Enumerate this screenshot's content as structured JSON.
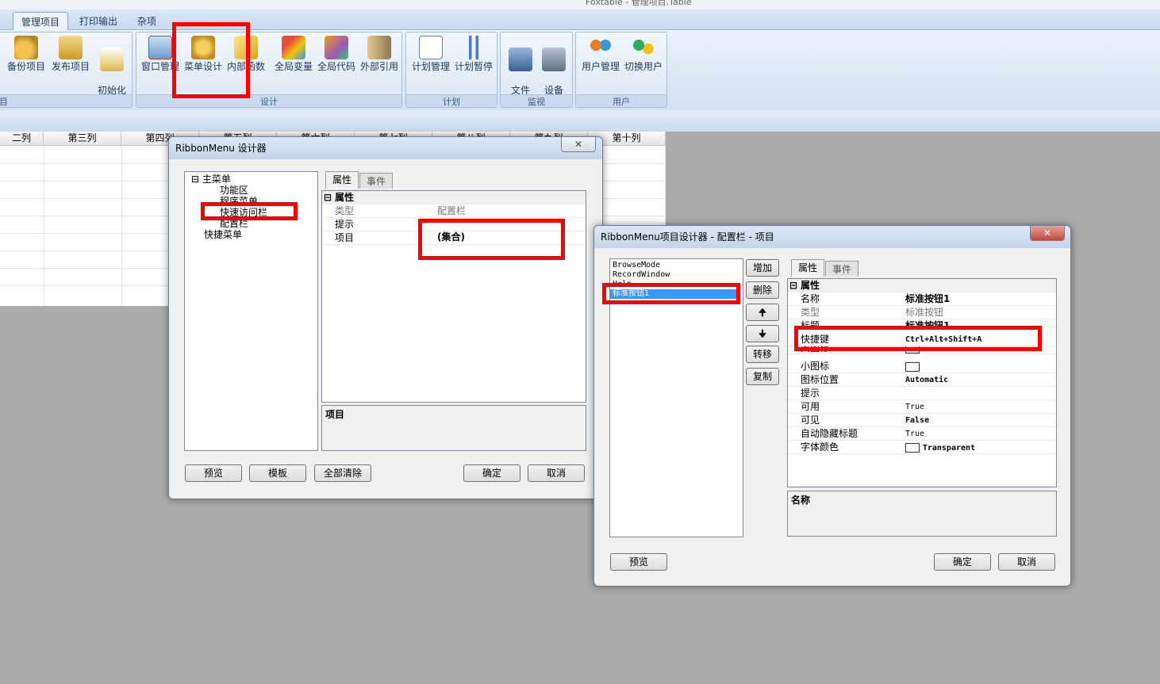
{
  "window_title": "Foxtable - 管理项目.Table",
  "tabs": [
    "管理项目",
    "打印输出",
    "杂项"
  ],
  "ribbon": {
    "groups": [
      {
        "label": "目",
        "buttons": [
          "备份项目",
          "发布项目",
          "初始化\n项目"
        ]
      },
      {
        "label": "设计",
        "buttons": [
          "窗口管理",
          "菜单设计",
          "内部函数",
          "全局变量",
          "全局代码",
          "外部引用"
        ]
      },
      {
        "label": "计划",
        "buttons": [
          "计划管理",
          "计划暂停"
        ]
      },
      {
        "label": "监视",
        "buttons": [
          "文件\n监视器",
          "设备\n监视器"
        ]
      },
      {
        "label": "用户",
        "buttons": [
          "用户管理",
          "切换用户"
        ]
      }
    ]
  },
  "grid": {
    "columns": [
      "二列",
      "第三列",
      "第四列",
      "第五列",
      "第六列",
      "第七列",
      "第八列",
      "第九列",
      "第十列"
    ]
  },
  "dialog1": {
    "title": "RibbonMenu 设计器",
    "close": "✕",
    "tree": {
      "root": "主菜单",
      "children": [
        "功能区",
        "程序菜单",
        "快速访问栏",
        "配置栏"
      ],
      "root2": "快捷菜单"
    },
    "tabs": [
      "属性",
      "事件"
    ],
    "section": "属性",
    "props": [
      {
        "k": "类型",
        "v": "配置栏"
      },
      {
        "k": "提示",
        "v": ""
      },
      {
        "k": "项目",
        "v": "(集合)"
      }
    ],
    "desc_title": "项目",
    "buttons": {
      "preview": "预览",
      "template": "模板",
      "clear": "全部清除",
      "ok": "确定",
      "cancel": "取消"
    }
  },
  "dialog2": {
    "title": "RibbonMenu项目设计器 - 配置栏 - 项目",
    "close": "✕",
    "list": [
      "BrowseMode",
      "RecordWindow",
      "Help",
      "标准按钮1"
    ],
    "side_buttons": {
      "add": "增加",
      "delete": "删除",
      "up": "🠉",
      "down": "🠋",
      "move": "转移",
      "copy": "复制"
    },
    "tabs": [
      "属性",
      "事件"
    ],
    "section": "属性",
    "props": [
      {
        "k": "名称",
        "v": "标准按钮1",
        "bold": true
      },
      {
        "k": "类型",
        "v": "标准按钮",
        "bold": false
      },
      {
        "k": "标题",
        "v": "标准按钮1",
        "bold": true
      },
      {
        "k": "快捷键",
        "v": "Ctrl+Alt+Shift+A",
        "bold": true
      },
      {
        "k": "大图标",
        "v": "",
        "bold": false
      },
      {
        "k": "小图标",
        "v": "",
        "bold": false
      },
      {
        "k": "图标位置",
        "v": "Automatic",
        "bold": true
      },
      {
        "k": "提示",
        "v": "",
        "bold": false
      },
      {
        "k": "可用",
        "v": "True",
        "bold": false
      },
      {
        "k": "可见",
        "v": "False",
        "bold": true
      },
      {
        "k": "自动隐藏标题",
        "v": "True",
        "bold": false
      },
      {
        "k": "字体颜色",
        "v": "Transparent",
        "bold": true
      }
    ],
    "desc_title": "名称",
    "buttons": {
      "preview": "预览",
      "ok": "确定",
      "cancel": "取消"
    }
  }
}
